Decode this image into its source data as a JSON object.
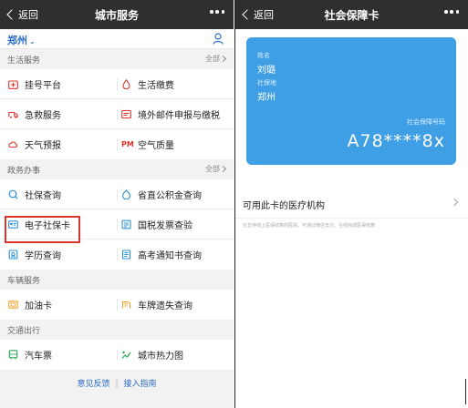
{
  "left": {
    "nav": {
      "back": "返回",
      "title": "城市服务"
    },
    "city": "郑州",
    "sections": [
      {
        "title": "生活服务",
        "all": "全部",
        "rows": [
          [
            {
              "icon": "hospital-icon",
              "label": "挂号平台"
            },
            {
              "icon": "water-drop-icon",
              "label": "生活缴费"
            }
          ],
          [
            {
              "icon": "ambulance-icon",
              "label": "急救服务"
            },
            {
              "icon": "mail-icon",
              "label": "境外邮件申报与缴税"
            }
          ],
          [
            {
              "icon": "cloud-icon",
              "label": "天气预报"
            },
            {
              "icon": "pm-icon",
              "label": "空气质量",
              "badge": "PM"
            }
          ]
        ]
      },
      {
        "title": "政务办事",
        "all": "全部",
        "rows": [
          [
            {
              "icon": "search-icon",
              "label": "社保查询"
            },
            {
              "icon": "fund-icon",
              "label": "省直公积金查询"
            }
          ],
          [
            {
              "icon": "id-card-icon",
              "label": "电子社保卡"
            },
            {
              "icon": "invoice-icon",
              "label": "国税发票查验"
            }
          ],
          [
            {
              "icon": "education-icon",
              "label": "学历查询"
            },
            {
              "icon": "notice-icon",
              "label": "高考通知书查询"
            }
          ]
        ]
      },
      {
        "title": "车辆服务",
        "rows": [
          [
            {
              "icon": "fuel-icon",
              "label": "加油卡"
            },
            {
              "icon": "license-plate-icon",
              "label": "车牌遗失查询"
            }
          ]
        ]
      },
      {
        "title": "交通出行",
        "rows": [
          [
            {
              "icon": "bus-icon",
              "label": "汽车票"
            },
            {
              "icon": "heatmap-icon",
              "label": "城市热力图"
            }
          ]
        ]
      }
    ],
    "footer": {
      "feedback": "意见反馈",
      "sep": "|",
      "guide": "接入指南"
    }
  },
  "right": {
    "nav": {
      "back": "返回",
      "title": "社会保障卡"
    },
    "card": {
      "name_label": "姓名",
      "name": "刘璐",
      "place_label": "社保地",
      "place": "郑州",
      "number_label": "社会保障号码",
      "number": "A78****8x"
    },
    "row": "可用此卡的医疗机构",
    "note": "在支持线上医保结算的医院，可通过微信支付，在线完成医保结算"
  },
  "colors": {
    "nav": "#2f2f2f",
    "card": "#3f9fe4",
    "accent": "#2b6cc7",
    "highlight": "#d9342b"
  }
}
